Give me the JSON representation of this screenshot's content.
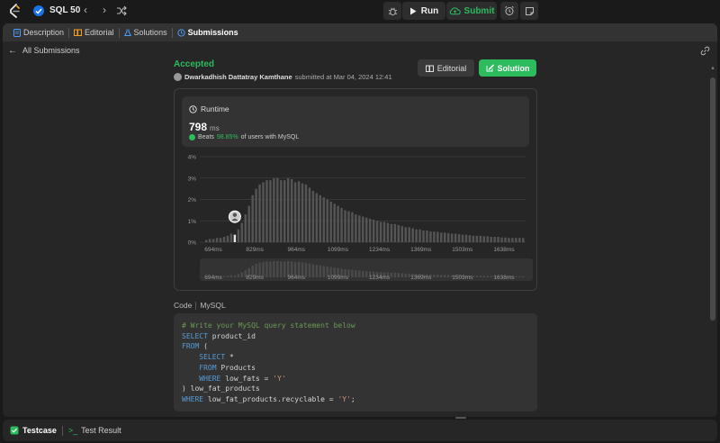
{
  "topnav": {
    "list_title": "SQL 50",
    "run_label": "Run",
    "submit_label": "Submit"
  },
  "tabs": [
    {
      "label": "Description"
    },
    {
      "label": "Editorial"
    },
    {
      "label": "Solutions"
    },
    {
      "label": "Submissions"
    }
  ],
  "back_label": "All Submissions",
  "submission": {
    "status": "Accepted",
    "user": "Dwarkadhish Dattatray Kamthane",
    "submitted_text": "submitted at Mar 04, 2024 12:41",
    "editorial_label": "Editorial",
    "solution_label": "Solution"
  },
  "runtime": {
    "label": "Runtime",
    "value": "798",
    "unit": "ms",
    "beats_prefix": "Beats",
    "beats_pct": "98.85%",
    "beats_suffix": "of users with MySQL"
  },
  "chart_data": {
    "type": "bar",
    "y_ticks": [
      "0%",
      "1%",
      "2%",
      "3%",
      "4%"
    ],
    "ylim": [
      0,
      4
    ],
    "x_tick_labels": [
      "694ms",
      "829ms",
      "964ms",
      "1099ms",
      "1234ms",
      "1369ms",
      "1503ms",
      "1638ms"
    ],
    "highlight_index": 8,
    "values": [
      0.1,
      0.15,
      0.15,
      0.2,
      0.2,
      0.25,
      0.3,
      0.4,
      0.35,
      0.6,
      0.9,
      1.3,
      1.7,
      2.2,
      2.5,
      2.7,
      2.8,
      2.9,
      2.9,
      3.0,
      3.0,
      2.9,
      2.9,
      3.0,
      2.95,
      2.8,
      2.85,
      2.75,
      2.7,
      2.55,
      2.4,
      2.3,
      2.2,
      2.1,
      2.0,
      1.9,
      1.8,
      1.7,
      1.6,
      1.5,
      1.45,
      1.4,
      1.3,
      1.25,
      1.2,
      1.15,
      1.1,
      1.05,
      1.0,
      0.95,
      0.95,
      0.9,
      0.85,
      0.85,
      0.8,
      0.75,
      0.7,
      0.7,
      0.65,
      0.6,
      0.6,
      0.55,
      0.55,
      0.5,
      0.5,
      0.48,
      0.45,
      0.45,
      0.42,
      0.4,
      0.4,
      0.38,
      0.35,
      0.35,
      0.33,
      0.3,
      0.3,
      0.3,
      0.28,
      0.28,
      0.25,
      0.25,
      0.25,
      0.22,
      0.22,
      0.2,
      0.2,
      0.2,
      0.2,
      0.2
    ]
  },
  "code": {
    "header_left": "Code",
    "header_right": "MySQL",
    "lines": [
      {
        "text": "# Write your MySQL query statement below",
        "kind": "comment"
      },
      {
        "text": "SELECT product_id",
        "kind": "code"
      },
      {
        "text": "FROM (",
        "kind": "code"
      },
      {
        "text": "    SELECT *",
        "kind": "code"
      },
      {
        "text": "    FROM Products",
        "kind": "code"
      },
      {
        "text": "    WHERE low_fats = 'Y'",
        "kind": "code"
      },
      {
        "text": ") low_fat_products",
        "kind": "code"
      },
      {
        "text": "WHERE low_fat_products.recyclable = 'Y';",
        "kind": "code"
      }
    ]
  },
  "bottom": {
    "testcase_label": "Testcase",
    "result_label": "Test Result"
  },
  "colors": {
    "accent_green": "#2cbb5d",
    "keyword_blue": "#569cd6",
    "comment_green": "#6a9955",
    "string_orange": "#ce9178"
  }
}
